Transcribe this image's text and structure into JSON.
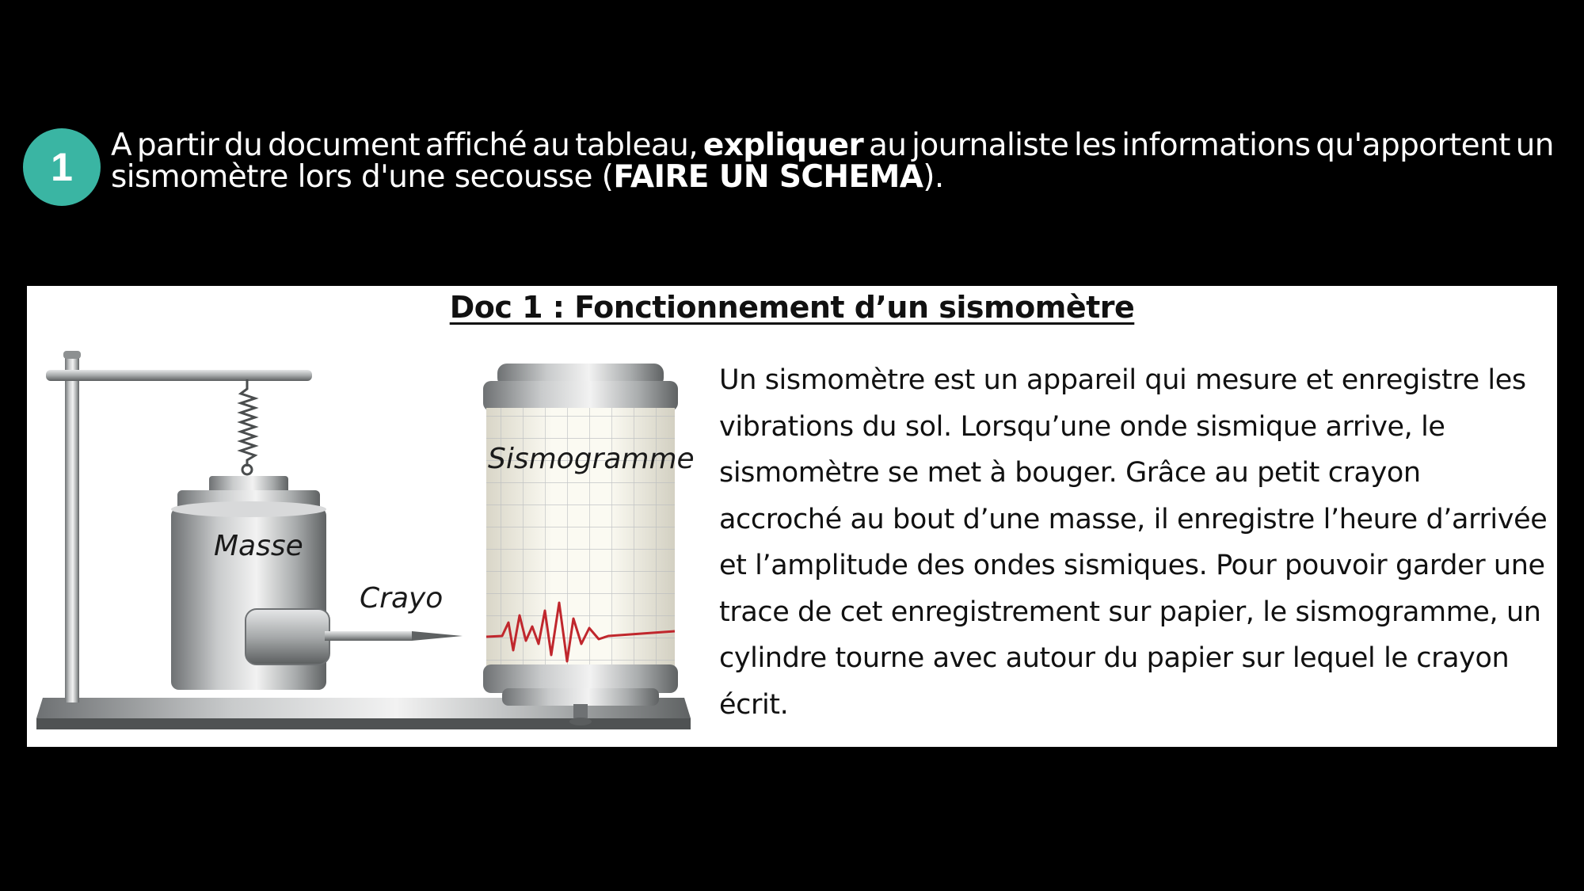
{
  "instruction": {
    "number": "1",
    "text_part1": "A partir du document affiché au tableau, ",
    "text_bold1": "expliquer",
    "text_part2": " au journaliste les informations qu'apportent un sismomètre lors d'une secousse (",
    "text_bold2": "FAIRE UN SCHEMA",
    "text_part3": ")."
  },
  "document": {
    "title": "Doc 1 : Fonctionnement d’un sismomètre",
    "paragraph": "Un sismomètre est un appareil qui mesure et enregistre les vibrations du sol. Lorsqu’une onde sismique arrive, le sismomètre se met à bouger. Grâce au petit crayon accroché au bout d’une masse, il enregistre l’heure d’arrivée et l’amplitude des ondes sismiques. Pour pouvoir garder une trace de cet enregistrement sur papier, le sismogramme, un cylindre tourne avec autour du papier sur lequel le crayon écrit.",
    "diagram": {
      "label_mass": "Masse",
      "label_pen": "Crayo",
      "label_drum": "Sismogramme"
    }
  },
  "colors": {
    "badge": "#3ab5a3",
    "background": "#000000",
    "panel": "#ffffff",
    "trace": "#c0272d"
  }
}
